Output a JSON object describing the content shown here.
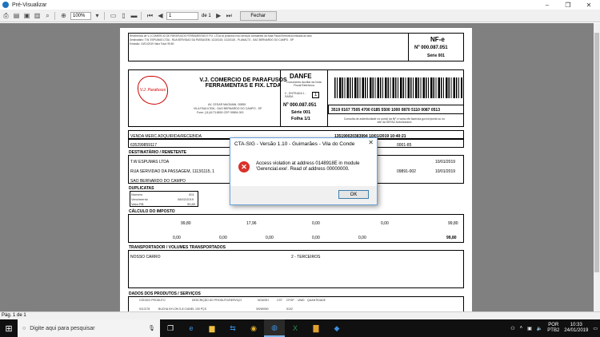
{
  "window": {
    "title": "Pré-Visualizar"
  },
  "toolbar": {
    "zoom": "100%",
    "page": "1",
    "page_of": "de 1",
    "close_label": "Fechar"
  },
  "status": {
    "page_info": "Pág. 1 de 1"
  },
  "danfe": {
    "header_line1": "Recebemos de V.J.COMERCIO DE PARAFUSOS FERRAMENTAS E FIX. LTDA os produtos e/ou serviços constantes da Nota Fiscal Eletrônica indicada ao lado",
    "header_line2": "Destinatário: T.W. ESPUMAS LTDA - RUA SERVIDAO DA PASSAGEM, 1113/1115, 1113/1115 - PLANALTO - SAO BERNARDO DO CAMPO - SP",
    "header_line3": "Emissão: 10/01/2019  Valor Total: 99,80",
    "nfe_label": "NF-e",
    "nfe_number": "Nº 000.087.051",
    "nfe_serie": "Série 001",
    "company_name": "V.J. COMERCIO DE PARAFUSOS FERRAMENTAS E FIX. LTDA",
    "company_addr1": "AV. CESAR MAGNANI, 00855",
    "company_addr2": "VILA PAULICEIA - SAO BERNARDO DO CAMPO - SP",
    "company_phone": "Fone: (11)4173-8500 CEP 09894-000",
    "logo_text": "V.J. Parafusos",
    "danfe_title": "DANFE",
    "danfe_sub": "Documento Auxiliar da Nota Fiscal Eletrônica",
    "entrada_saida": "0 - ENTRADA  1 - SAÍDA",
    "tipo": "1",
    "number2": "Nº 000.087.051",
    "serie2": "Série 001",
    "folha": "Folha 1/1",
    "chave": "3519 0167 7505 4700 0185 5500 1000 0870 5110 0087 0513",
    "consulta": "Consulta de autenticidade no portal da NF-e www.nfe.fazenda.gov.br/portal ou no site da SEFAZ Autorizadora",
    "natureza": "VENDA MERC ADQUIRIDA/RECEBIDA",
    "protocolo": "135190020383994 10/01/2019 10:40:21",
    "ie": "635299859117",
    "cnpj": "0001-85",
    "dest_section": "DESTINATÁRIO / REMETENTE",
    "dest_name": "T.W ESPUMAS LTDA",
    "dest_addr": "RUA SERVIDAO DA PASSAGEM, 1113/1115, 1",
    "dest_city": "SAO BERNARDO DO CAMPO",
    "dest_cep": "09891-002",
    "dest_date1": "10/01/2019",
    "dest_date2": "10/01/2019",
    "dup_section": "DUPLICATAS",
    "dup_numero_lbl": "Número",
    "dup_numero": "001",
    "dup_venc_lbl": "Vencimento",
    "dup_venc": "08/02/2019",
    "dup_valor_lbl": "Valor R$",
    "dup_valor": "99,80",
    "imposto_section": "CÁLCULO DO IMPOSTO",
    "base_icms": "99,80",
    "valor_icms": "17,96",
    "zero": "0,00",
    "valor_total": "99,80",
    "transp_section": "TRANSPORTADOR / VOLUMES TRANSPORTADOS",
    "transp_name": "NOSSO CARRO",
    "frete": "2 - TERCEIROS",
    "produtos_section": "DADOS DOS PRODUTOS / SERVIÇOS",
    "col_codigo": "CÓDIGO PRODUTO",
    "col_desc": "DESCRIÇÃO DO PRODUTO/SERVIÇO",
    "col_ncm": "NCM/SH",
    "col_cst": "CST",
    "col_cfop": "CFOP",
    "col_unid": "UNID",
    "col_qtd": "QUANTIDADE",
    "row1_cod": "9112178",
    "row1_desc": "BUCHA NYLON S-8 C/ANEL 100 PÇS",
    "row1_ncm": "39269090",
    "row1_cfop": "5102"
  },
  "dialog": {
    "title": "CTA-SIG - Versão 1.10 - Guimarães - Vila do Conde",
    "message": "Access violation at address 0148918E in module 'Gerencial.exe'. Read of address 00000000.",
    "ok_label": "OK"
  },
  "taskbar": {
    "search_placeholder": "Digite aqui para pesquisar",
    "lang": "POR",
    "lang2": "PTB2",
    "time": "10:33",
    "date": "24/01/2019"
  },
  "colors": {
    "accent": "#1e73be",
    "error": "#d9302b",
    "viewer_bg": "#808080"
  }
}
